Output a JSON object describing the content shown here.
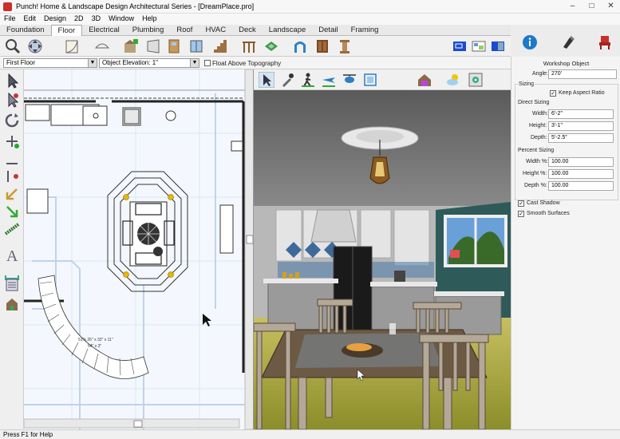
{
  "window": {
    "title": "Punch! Home & Landscape Design Architectural Series - [DreamPlace.pro]",
    "min_glyph": "–",
    "max_glyph": "□",
    "close_glyph": "✕"
  },
  "menu": [
    "File",
    "Edit",
    "Design",
    "2D",
    "3D",
    "Window",
    "Help"
  ],
  "tabs": [
    "Foundation",
    "Floor",
    "Electrical",
    "Plumbing",
    "Roof",
    "HVAC",
    "Deck",
    "Landscape",
    "Detail",
    "Framing"
  ],
  "active_tab": "Floor",
  "options_bar": {
    "floor_select": "First Floor",
    "object_elevation_label": "Object Elevation: 1\"",
    "float_label": "Float Above Topography"
  },
  "plan": {
    "stair_label_1": "51% 26\" x 33\" x 11\"",
    "stair_label_2": "54\" x 3\""
  },
  "properties": {
    "header": "Workshop Object",
    "angle_label": "Angle:",
    "angle_value": "270'",
    "sizing_title": "Sizing",
    "keep_aspect": "Keep Aspect Ratio",
    "direct_title": "Direct Sizing",
    "width_label": "Width:",
    "width_value": "6'-2\"",
    "height_label": "Height:",
    "height_value": "3'-1\"",
    "depth_label": "Depth:",
    "depth_value": "5'-2.5\"",
    "percent_title": "Percent Sizing",
    "width_pct_label": "Width %:",
    "width_pct_value": "100.00",
    "height_pct_label": "Height %:",
    "height_pct_value": "100.00",
    "depth_pct_label": "Depth %:",
    "depth_pct_value": "100.00",
    "cast_shadow": "Cast Shadow",
    "smooth_surfaces": "Smooth Surfaces"
  },
  "status": "Press F1 for Help",
  "colors": {
    "accent_blue": "#1f78c8",
    "wall_green": "#2f5a5a",
    "floor_yellow": "#a8b43a",
    "table_wood": "#6d5a44"
  }
}
